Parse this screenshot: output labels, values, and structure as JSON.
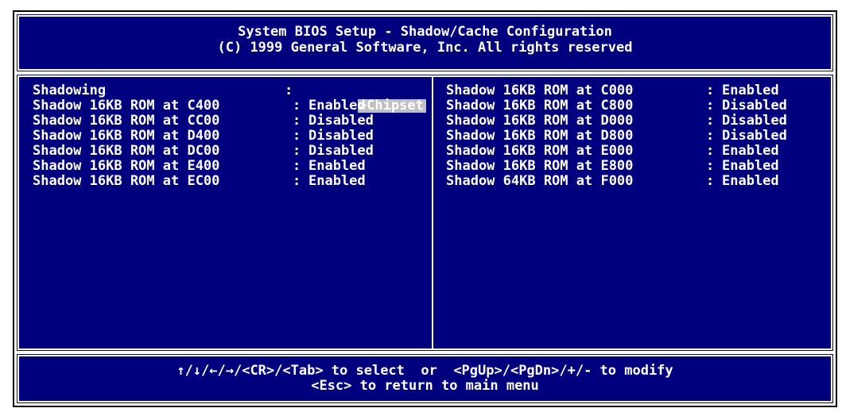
{
  "header": {
    "title": "System BIOS Setup - Shadow/Cache Configuration",
    "copyright": "(C) 1999 General Software, Inc. All rights reserved"
  },
  "left_panel": {
    "items": [
      {
        "label": "Shadowing",
        "value": "Chipset",
        "selected": true
      },
      {
        "label": "Shadow 16KB ROM at C400",
        "value": "Enabled"
      },
      {
        "label": "Shadow 16KB ROM at CC00",
        "value": "Disabled"
      },
      {
        "label": "Shadow 16KB ROM at D400",
        "value": "Disabled"
      },
      {
        "label": "Shadow 16KB ROM at DC00",
        "value": "Disabled"
      },
      {
        "label": "Shadow 16KB ROM at E400",
        "value": "Enabled"
      },
      {
        "label": "Shadow 16KB ROM at EC00",
        "value": "Enabled"
      }
    ]
  },
  "right_panel": {
    "items": [
      {
        "label": "Shadow 16KB ROM at C000",
        "value": "Enabled"
      },
      {
        "label": "Shadow 16KB ROM at C800",
        "value": "Disabled"
      },
      {
        "label": "Shadow 16KB ROM at D000",
        "value": "Disabled"
      },
      {
        "label": "Shadow 16KB ROM at D800",
        "value": "Disabled"
      },
      {
        "label": "Shadow 16KB ROM at E000",
        "value": "Enabled"
      },
      {
        "label": "Shadow 16KB ROM at E800",
        "value": "Enabled"
      },
      {
        "label": "Shadow 64KB ROM at F000",
        "value": "Enabled"
      }
    ]
  },
  "footer": {
    "line1": "↑/↓/←/→/<CR>/<Tab> to select  or  <PgUp>/<PgDn>/+/- to modify",
    "line2": "<Esc> to return to main menu"
  },
  "separator": ":",
  "cursor_glyph": ">",
  "colors": {
    "background": "#00007f",
    "text": "#ffffff",
    "highlight": "#c0c0c0"
  }
}
